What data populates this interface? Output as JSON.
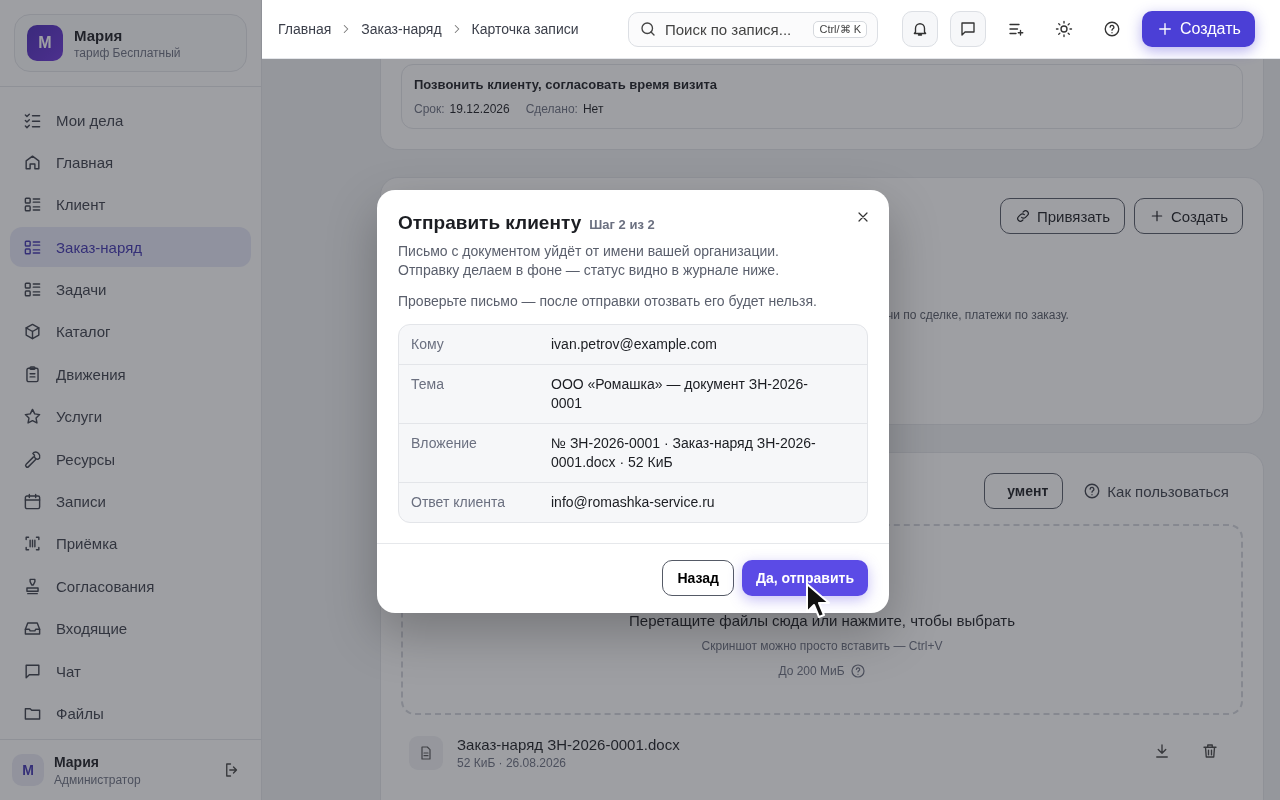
{
  "sidebar": {
    "profile": {
      "avatar": "М",
      "name": "Мария",
      "plan": "тариф Бесплатный"
    },
    "nav": [
      {
        "label": "Мои дела",
        "selected": false
      },
      {
        "label": "Главная",
        "selected": false
      },
      {
        "label": "Клиент",
        "selected": false
      },
      {
        "label": "Заказ-наряд",
        "selected": true
      },
      {
        "label": "Задачи",
        "selected": false
      },
      {
        "label": "Каталог",
        "selected": false
      },
      {
        "label": "Движения",
        "selected": false
      },
      {
        "label": "Услуги",
        "selected": false
      },
      {
        "label": "Ресурсы",
        "selected": false
      },
      {
        "label": "Записи",
        "selected": false
      },
      {
        "label": "Приёмка",
        "selected": false
      },
      {
        "label": "Согласования",
        "selected": false
      },
      {
        "label": "Входящие",
        "selected": false
      },
      {
        "label": "Чат",
        "selected": false
      },
      {
        "label": "Файлы",
        "selected": false
      }
    ],
    "user": {
      "avatar": "М",
      "name": "Мария",
      "role": "Администратор"
    }
  },
  "topbar": {
    "breadcrumbs": [
      "Главная",
      "Заказ-наряд",
      "Карточка записи"
    ],
    "search": {
      "placeholder": "Поиск по запися...",
      "shortcut": "Ctrl/⌘ K"
    },
    "create_button": "Создать"
  },
  "task_card": {
    "title": "Позвонить клиенту, согласовать время визита",
    "fields": [
      {
        "label": "Срок:",
        "value": "19.12.2026"
      },
      {
        "label": "Сделано:",
        "value": "Нет"
      }
    ]
  },
  "links_card": {
    "buttons": [
      "Привязать",
      "Создать"
    ],
    "hint": "чи по сделке, платежи по заказу."
  },
  "files_card": {
    "document_button": "умент",
    "help_link": "Как пользоваться",
    "dropzone": {
      "title": "Перетащите файлы сюда или нажмите, чтобы выбрать",
      "hint": "Скриншот можно просто вставить — Ctrl+V",
      "limit": "До 200 МиБ"
    },
    "files": [
      {
        "name": "Заказ-наряд ЗН-2026-0001.docx",
        "meta": "52 КиБ · 26.08.2026"
      }
    ]
  },
  "modal": {
    "title": "Отправить клиенту",
    "step": "Шаг 2 из 2",
    "description": [
      "Письмо с документом уйдёт от имени вашей организации.",
      "Отправку делаем в фоне — статус видно в журнале ниже."
    ],
    "warning": "Проверьте письмо — после отправки отозвать его будет нельзя.",
    "rows": [
      {
        "label": "Кому",
        "value": "ivan.petrov@example.com"
      },
      {
        "label": "Тема",
        "value": "ООО «Ромашка» — документ ЗН-2026-0001"
      },
      {
        "label": "Вложение",
        "value": "№ ЗН-2026-0001 · Заказ-наряд ЗН-2026-0001.docx · 52 КиБ"
      },
      {
        "label": "Ответ клиента",
        "value": "info@romashka-service.ru"
      }
    ],
    "buttons": {
      "back": "Назад",
      "confirm": "Да, отправить"
    }
  }
}
